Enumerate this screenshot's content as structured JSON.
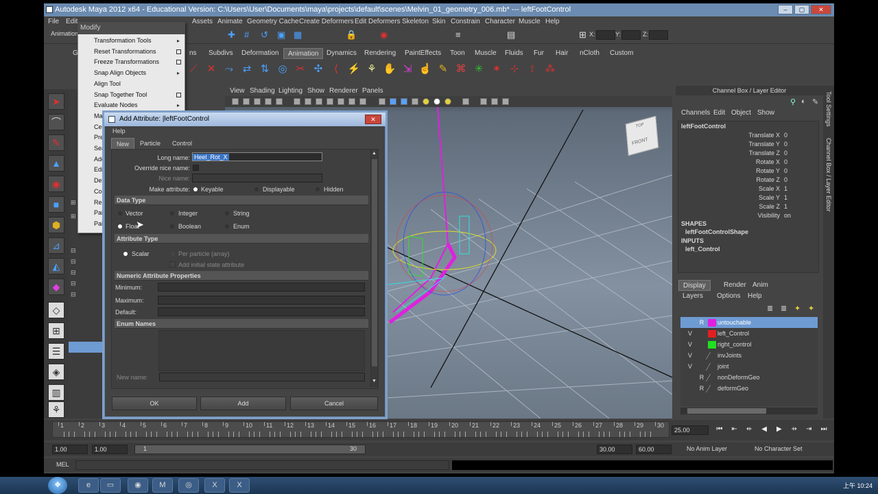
{
  "window": {
    "title": "Autodesk Maya 2012 x64 - Educational Version: C:\\Users\\User\\Documents\\maya\\projects\\default\\scenes\\Melvin_01_geometry_006.mb*  ---  leftFootControl",
    "controls": [
      "–",
      "▢",
      "✕"
    ]
  },
  "menubar": {
    "items": [
      "File",
      "Edit",
      "Assets",
      "Animate",
      "Geometry Cache",
      "Create Deformers",
      "Edit Deformers",
      "Skeleton",
      "Skin",
      "Constrain",
      "Character",
      "Muscle",
      "Help"
    ],
    "prefix_left": "Animation",
    "coords": {
      "x_label": "X:",
      "y_label": "Y:",
      "z_label": "Z:"
    }
  },
  "shelf_tabs": {
    "items": [
      "General",
      "ns",
      "Subdivs",
      "Deformation",
      "Animation",
      "Dynamics",
      "Rendering",
      "PaintEffects",
      "Toon",
      "Muscle",
      "Fluids",
      "Fur",
      "Hair",
      "nCloth",
      "Custom"
    ],
    "active": "Animation"
  },
  "modify_menu": {
    "title": "Modify",
    "items": [
      {
        "label": "Transformation Tools",
        "kind": "arrow"
      },
      {
        "label": "Reset Transformations",
        "kind": "box"
      },
      {
        "label": "Freeze Transformations",
        "kind": "box"
      },
      {
        "label": "Snap Align Objects",
        "kind": "arrow"
      },
      {
        "label": "Align Tool",
        "kind": "none"
      },
      {
        "label": "Snap Together Tool",
        "kind": "box"
      },
      {
        "label": "Evaluate Nodes",
        "kind": "arrow"
      },
      {
        "label": "Make",
        "kind": "none"
      },
      {
        "label": "Cent",
        "kind": "none"
      },
      {
        "label": "Pref",
        "kind": "none"
      },
      {
        "label": "Sear",
        "kind": "none"
      },
      {
        "label": "Add",
        "kind": "none"
      },
      {
        "label": "Edit",
        "kind": "none"
      },
      {
        "label": "Dele",
        "kind": "none"
      },
      {
        "label": "Conv",
        "kind": "none"
      },
      {
        "label": "Repl",
        "kind": "none"
      },
      {
        "label": "Pain",
        "kind": "none"
      },
      {
        "label": "Pain",
        "kind": "none"
      }
    ]
  },
  "viewport": {
    "menu": [
      "View",
      "Shading",
      "Lighting",
      "Show",
      "Renderer",
      "Panels"
    ],
    "viewcube": {
      "top": "TOP",
      "front": "FRONT"
    }
  },
  "dialog": {
    "title": "Add Attribute: |leftFootControl",
    "menu_help": "Help",
    "tabs": [
      "New",
      "Particle",
      "Control"
    ],
    "active_tab": "New",
    "long_name_label": "Long name:",
    "long_name_value": "Heel_Rot_X",
    "override_label": "Override nice name:",
    "nice_name_label": "Nice name:",
    "make_attr_label": "Make attribute:",
    "make_attr_options": [
      "Keyable",
      "Displayable",
      "Hidden"
    ],
    "make_attr_selected": "Keyable",
    "data_type_header": "Data Type",
    "data_types": [
      "Vector",
      "Integer",
      "String",
      "Float",
      "Boolean",
      "Enum"
    ],
    "data_type_selected": "Float",
    "attr_type_header": "Attribute Type",
    "attr_types": [
      "Scalar",
      "Per particle (array)"
    ],
    "attr_type_selected": "Scalar",
    "initial_state_label": "Add initial state attribute",
    "numeric_header": "Numeric Attribute Properties",
    "minimum_label": "Minimum:",
    "maximum_label": "Maximum:",
    "default_label": "Default:",
    "enum_header": "Enum Names",
    "new_name_label": "New name:",
    "buttons": {
      "ok": "OK",
      "add": "Add",
      "cancel": "Cancel"
    }
  },
  "channel_box": {
    "header": "Channel Box / Layer Editor",
    "menu": [
      "Channels",
      "Edit",
      "Object",
      "Show"
    ],
    "object_name": "leftFootControl",
    "attributes": [
      {
        "name": "Translate X",
        "value": "0"
      },
      {
        "name": "Translate Y",
        "value": "0"
      },
      {
        "name": "Translate Z",
        "value": "0"
      },
      {
        "name": "Rotate X",
        "value": "0"
      },
      {
        "name": "Rotate Y",
        "value": "0"
      },
      {
        "name": "Rotate Z",
        "value": "0"
      },
      {
        "name": "Scale X",
        "value": "1"
      },
      {
        "name": "Scale Y",
        "value": "1"
      },
      {
        "name": "Scale Z",
        "value": "1"
      },
      {
        "name": "Visibility",
        "value": "on"
      }
    ],
    "shapes_label": "SHAPES",
    "shape_name": "leftFootControlShape",
    "inputs_label": "INPUTS",
    "input_name": "left_Control"
  },
  "layer_editor": {
    "tabs": [
      "Display",
      "Render",
      "Anim"
    ],
    "active_tab": "Display",
    "menu": [
      "Layers",
      "Options",
      "Help"
    ],
    "layers": [
      {
        "name": "untouchable",
        "v": "",
        "r": "R",
        "color": "#e020e0",
        "selected": true
      },
      {
        "name": "left_Control",
        "v": "V",
        "r": "",
        "color": "#e02020",
        "selected": false
      },
      {
        "name": "right_control",
        "v": "V",
        "r": "",
        "color": "#20e020",
        "selected": false
      },
      {
        "name": "invJoints",
        "v": "V",
        "r": "",
        "color": "",
        "selected": false
      },
      {
        "name": "joint",
        "v": "V",
        "r": "",
        "color": "",
        "selected": false
      },
      {
        "name": "nonDeformGeo",
        "v": "",
        "r": "R",
        "color": "",
        "selected": false
      },
      {
        "name": "deformGeo",
        "v": "",
        "r": "R",
        "color": "",
        "selected": false
      }
    ]
  },
  "right_vtabs": {
    "tool_settings": "Tool Settings",
    "channel_box": "Channel Box / Layer Editor"
  },
  "timeline": {
    "ticks": [
      "1",
      "2",
      "3",
      "4",
      "5",
      "6",
      "7",
      "8",
      "9",
      "10",
      "11",
      "12",
      "13",
      "14",
      "15",
      "16",
      "17",
      "18",
      "19",
      "20",
      "21",
      "22",
      "23",
      "24",
      "25",
      "26",
      "27",
      "28",
      "29",
      "30"
    ],
    "current_frame": "25.00"
  },
  "range": {
    "start": "1.00",
    "playback_start": "1.00",
    "slider_start": "1",
    "slider_end": "30",
    "playback_end": "30.00",
    "end": "60.00",
    "anim_layer": "No Anim Layer",
    "character_set": "No Character Set"
  },
  "mel": {
    "label": "MEL"
  },
  "taskbar": {
    "clock": "上午 10:24"
  }
}
